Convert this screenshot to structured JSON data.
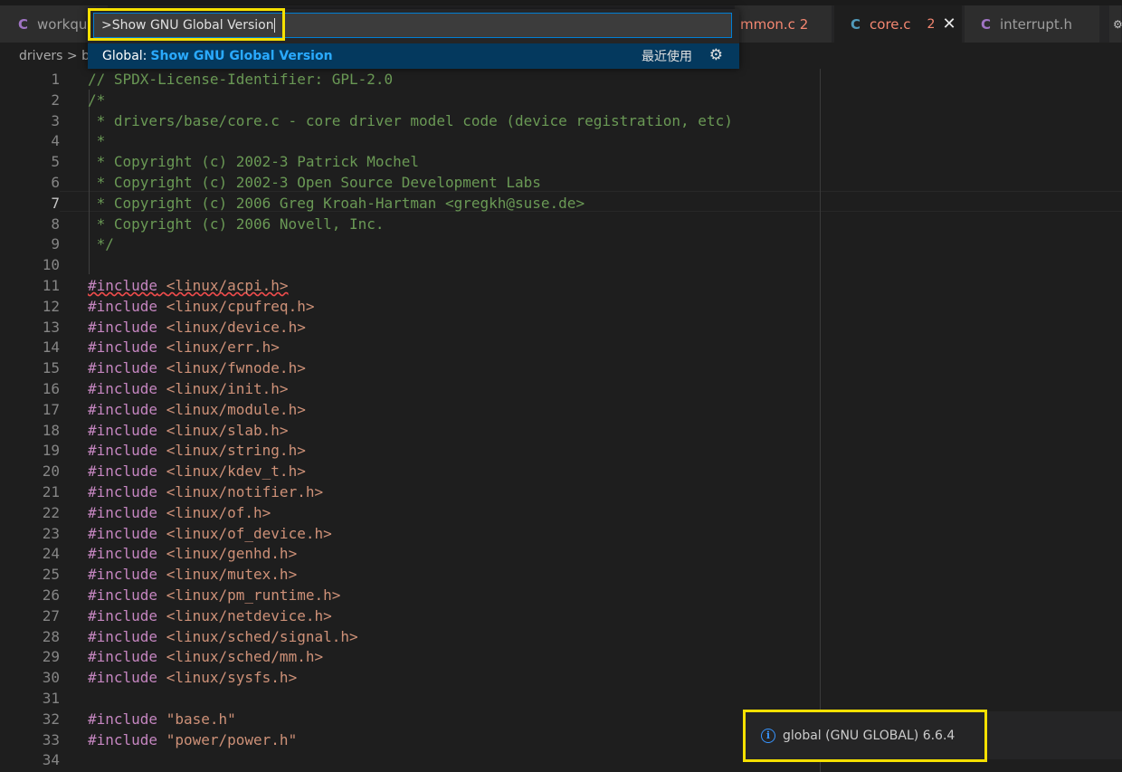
{
  "tabs": {
    "workqueue": {
      "icon": "C",
      "label": "workque"
    },
    "common": {
      "label": "mmon.c 2"
    },
    "core": {
      "icon": "C",
      "label": "core.c",
      "problems": "2",
      "close": "✕"
    },
    "interrupt": {
      "icon": "C",
      "label": "interrupt.h"
    },
    "more": "⚙"
  },
  "breadcrumb": {
    "text": "drivers > b"
  },
  "palette": {
    "input_value": ">Show GNU Global Version",
    "item_category": "Global:",
    "item_label": "Show GNU Global Version",
    "item_recent": "最近使用",
    "gear_icon": "⚙"
  },
  "code_lines": [
    {
      "n": "1",
      "parts": [
        [
          "comment",
          "// SPDX-License-Identifier: GPL-2.0"
        ]
      ]
    },
    {
      "n": "2",
      "parts": [
        [
          "comment",
          "/*"
        ]
      ]
    },
    {
      "n": "3",
      "parts": [
        [
          "comment",
          " * drivers/base/core.c - core driver model code (device registration, etc)"
        ]
      ]
    },
    {
      "n": "4",
      "parts": [
        [
          "comment",
          " *"
        ]
      ]
    },
    {
      "n": "5",
      "parts": [
        [
          "comment",
          " * Copyright (c) 2002-3 Patrick Mochel"
        ]
      ]
    },
    {
      "n": "6",
      "parts": [
        [
          "comment",
          " * Copyright (c) 2002-3 Open Source Development Labs"
        ]
      ]
    },
    {
      "n": "7",
      "parts": [
        [
          "comment",
          " * Copyright (c) 2006 Greg Kroah-Hartman <gregkh@suse.de>"
        ]
      ]
    },
    {
      "n": "8",
      "parts": [
        [
          "comment",
          " * Copyright (c) 2006 Novell, Inc."
        ]
      ]
    },
    {
      "n": "9",
      "parts": [
        [
          "comment",
          " */"
        ]
      ]
    },
    {
      "n": "10",
      "parts": []
    },
    {
      "n": "11",
      "parts": [
        [
          "kw squiggle",
          "#include"
        ],
        [
          "squiggle",
          " "
        ],
        [
          "str squiggle",
          "<linux/acpi.h>"
        ]
      ]
    },
    {
      "n": "12",
      "parts": [
        [
          "kw",
          "#include"
        ],
        [
          "",
          " "
        ],
        [
          "str",
          "<linux/cpufreq.h>"
        ]
      ]
    },
    {
      "n": "13",
      "parts": [
        [
          "kw",
          "#include"
        ],
        [
          "",
          " "
        ],
        [
          "str",
          "<linux/device.h>"
        ]
      ]
    },
    {
      "n": "14",
      "parts": [
        [
          "kw",
          "#include"
        ],
        [
          "",
          " "
        ],
        [
          "str",
          "<linux/err.h>"
        ]
      ]
    },
    {
      "n": "15",
      "parts": [
        [
          "kw",
          "#include"
        ],
        [
          "",
          " "
        ],
        [
          "str",
          "<linux/fwnode.h>"
        ]
      ]
    },
    {
      "n": "16",
      "parts": [
        [
          "kw",
          "#include"
        ],
        [
          "",
          " "
        ],
        [
          "str",
          "<linux/init.h>"
        ]
      ]
    },
    {
      "n": "17",
      "parts": [
        [
          "kw",
          "#include"
        ],
        [
          "",
          " "
        ],
        [
          "str",
          "<linux/module.h>"
        ]
      ]
    },
    {
      "n": "18",
      "parts": [
        [
          "kw",
          "#include"
        ],
        [
          "",
          " "
        ],
        [
          "str",
          "<linux/slab.h>"
        ]
      ]
    },
    {
      "n": "19",
      "parts": [
        [
          "kw",
          "#include"
        ],
        [
          "",
          " "
        ],
        [
          "str",
          "<linux/string.h>"
        ]
      ]
    },
    {
      "n": "20",
      "parts": [
        [
          "kw",
          "#include"
        ],
        [
          "",
          " "
        ],
        [
          "str",
          "<linux/kdev_t.h>"
        ]
      ]
    },
    {
      "n": "21",
      "parts": [
        [
          "kw",
          "#include"
        ],
        [
          "",
          " "
        ],
        [
          "str",
          "<linux/notifier.h>"
        ]
      ]
    },
    {
      "n": "22",
      "parts": [
        [
          "kw",
          "#include"
        ],
        [
          "",
          " "
        ],
        [
          "str",
          "<linux/of.h>"
        ]
      ]
    },
    {
      "n": "23",
      "parts": [
        [
          "kw",
          "#include"
        ],
        [
          "",
          " "
        ],
        [
          "str",
          "<linux/of_device.h>"
        ]
      ]
    },
    {
      "n": "24",
      "parts": [
        [
          "kw",
          "#include"
        ],
        [
          "",
          " "
        ],
        [
          "str",
          "<linux/genhd.h>"
        ]
      ]
    },
    {
      "n": "25",
      "parts": [
        [
          "kw",
          "#include"
        ],
        [
          "",
          " "
        ],
        [
          "str",
          "<linux/mutex.h>"
        ]
      ]
    },
    {
      "n": "26",
      "parts": [
        [
          "kw",
          "#include"
        ],
        [
          "",
          " "
        ],
        [
          "str",
          "<linux/pm_runtime.h>"
        ]
      ]
    },
    {
      "n": "27",
      "parts": [
        [
          "kw",
          "#include"
        ],
        [
          "",
          " "
        ],
        [
          "str",
          "<linux/netdevice.h>"
        ]
      ]
    },
    {
      "n": "28",
      "parts": [
        [
          "kw",
          "#include"
        ],
        [
          "",
          " "
        ],
        [
          "str",
          "<linux/sched/signal.h>"
        ]
      ]
    },
    {
      "n": "29",
      "parts": [
        [
          "kw",
          "#include"
        ],
        [
          "",
          " "
        ],
        [
          "str",
          "<linux/sched/mm.h>"
        ]
      ]
    },
    {
      "n": "30",
      "parts": [
        [
          "kw",
          "#include"
        ],
        [
          "",
          " "
        ],
        [
          "str",
          "<linux/sysfs.h>"
        ]
      ]
    },
    {
      "n": "31",
      "parts": []
    },
    {
      "n": "32",
      "parts": [
        [
          "kw",
          "#include"
        ],
        [
          "",
          " "
        ],
        [
          "str",
          "\"base.h\""
        ]
      ]
    },
    {
      "n": "33",
      "parts": [
        [
          "kw",
          "#include"
        ],
        [
          "",
          " "
        ],
        [
          "str",
          "\"power/power.h\""
        ]
      ]
    },
    {
      "n": "34",
      "parts": []
    }
  ],
  "current_line": "7",
  "notification": {
    "icon": "i",
    "message": "global (GNU GLOBAL) 6.6.4"
  },
  "colors": {
    "accent": "#007fd4",
    "highlight_box": "#f5e000",
    "selected_item": "#04395e"
  }
}
